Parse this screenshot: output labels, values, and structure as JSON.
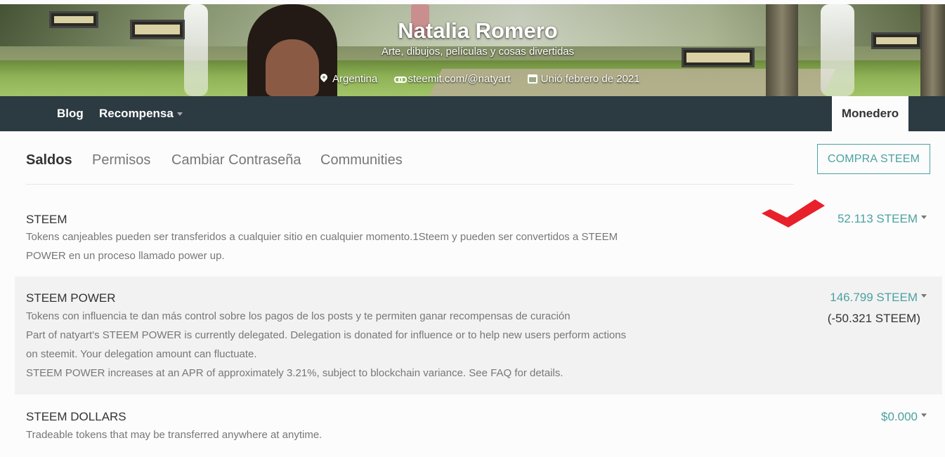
{
  "profile": {
    "name": "Natalia Romero",
    "about": "Arte, dibujos, películas y cosas divertidas",
    "location": "Argentina",
    "website": "steemit.com/@natyart",
    "joined": "Unió febrero de 2021"
  },
  "nav": {
    "blog": "Blog",
    "rewards": "Recompensa",
    "wallet": "Monedero"
  },
  "tabs": {
    "balances": "Saldos",
    "permissions": "Permisos",
    "change_password": "Cambiar Contraseña",
    "communities": "Communities"
  },
  "buy_button": "COMPRA STEEM",
  "balances": {
    "steem": {
      "title": "STEEM",
      "desc": "Tokens canjeables pueden ser transferidos a cualquier sitio en cualquier momento.1Steem y pueden ser convertidos a STEEM POWER en un proceso llamado power up.",
      "value": "52.113 STEEM"
    },
    "steem_power": {
      "title": "STEEM POWER",
      "desc_1": "Tokens con influencia te dan más control sobre los pagos de los posts y te permiten ganar recompensas de curación",
      "desc_2": "Part of natyart's STEEM POWER is currently delegated. Delegation is donated for influence or to help new users perform actions on steemit. Your delegation amount can fluctuate.",
      "desc_3": "STEEM POWER increases at an APR of approximately 3.21%, subject to blockchain variance. See FAQ for details.",
      "value": "146.799 STEEM",
      "delegated": "(-50.321 STEEM)"
    },
    "steem_dollars": {
      "title": "STEEM DOLLARS",
      "desc": "Tradeable tokens that may be transferred anywhere at anytime.",
      "value": "$0.000"
    }
  },
  "icons": {
    "location": "location-pin-icon",
    "website": "link-icon",
    "joined": "calendar-icon",
    "dropdown": "caret-down-icon"
  },
  "colors": {
    "accent": "#4ba2a0",
    "navbar": "#2c3a42",
    "annotation": "#e8202a"
  }
}
